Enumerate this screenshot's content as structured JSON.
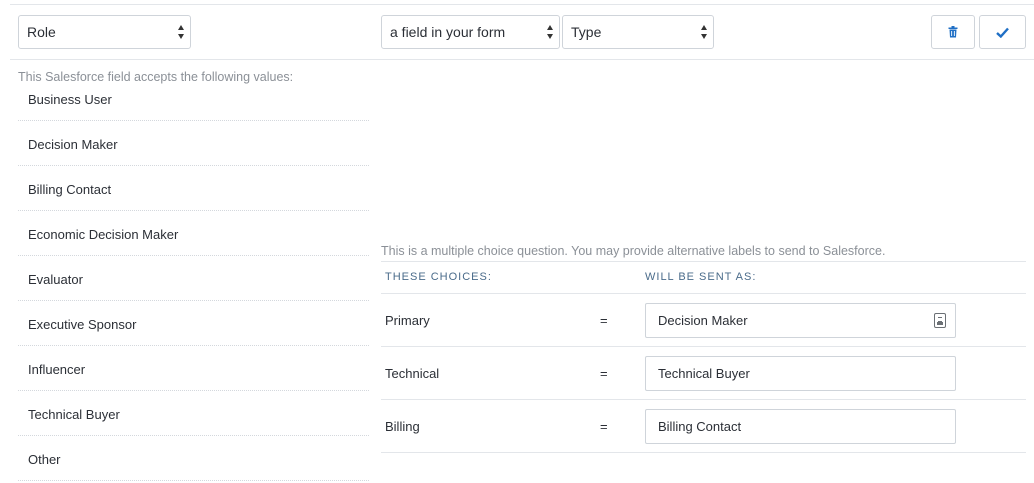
{
  "mapping_row": {
    "salesforce_field": "Role",
    "source_selector": "a field in your form",
    "form_field": "Type",
    "delete_icon": "trash-icon",
    "confirm_icon": "checkmark-icon"
  },
  "accepted_values": {
    "note": "This Salesforce field accepts the following values:",
    "items": [
      "Business User",
      "Decision Maker",
      "Billing Contact",
      "Economic Decision Maker",
      "Evaluator",
      "Executive Sponsor",
      "Influencer",
      "Technical Buyer",
      "Other"
    ]
  },
  "choice_mapping": {
    "note": "This is a multiple choice question. You may provide alternative labels to send to Salesforce.",
    "col_choices": "THESE CHOICES:",
    "col_sent_as": "WILL BE SENT AS:",
    "rows": [
      {
        "choice": "Primary",
        "equals": "=",
        "sent_as": "Decision Maker",
        "has_icon": true
      },
      {
        "choice": "Technical",
        "equals": "=",
        "sent_as": "Technical Buyer",
        "has_icon": false
      },
      {
        "choice": "Billing",
        "equals": "=",
        "sent_as": "Billing Contact",
        "has_icon": false
      }
    ]
  },
  "colors": {
    "accent_blue": "#1f6fc5",
    "header_text": "#4a6b8a",
    "muted_text": "#8b9097"
  }
}
